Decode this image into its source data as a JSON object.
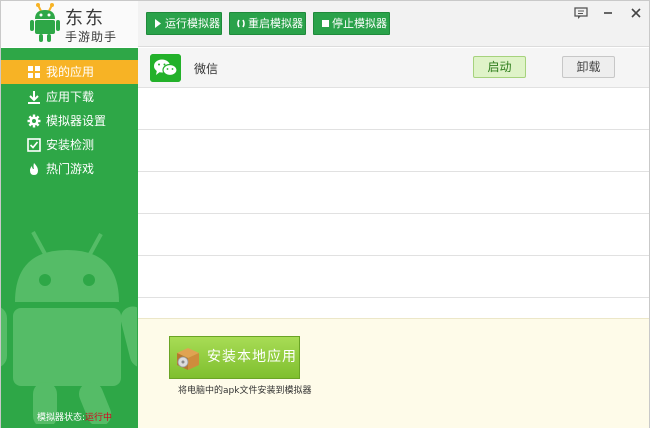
{
  "brand": {
    "name": "东东",
    "sub": "手游助手"
  },
  "toolbar": {
    "run_label": "运行模拟器",
    "restart_label": "重启模拟器",
    "stop_label": "停止模拟器"
  },
  "window_controls": [
    "message-icon",
    "minimize-icon",
    "close-icon"
  ],
  "sidebar": {
    "items": [
      {
        "label": "我的应用",
        "icon": "grid-icon",
        "active": true
      },
      {
        "label": "应用下载",
        "icon": "download-icon",
        "active": false
      },
      {
        "label": "模拟器设置",
        "icon": "gear-icon",
        "active": false
      },
      {
        "label": "安装检测",
        "icon": "checkbox-icon",
        "active": false
      },
      {
        "label": "热门游戏",
        "icon": "hot-icon",
        "active": false
      }
    ],
    "status_label": "模拟器状态:",
    "status_value": "运行中"
  },
  "apps": [
    {
      "name": "微信",
      "icon": "wechat-icon",
      "launch_label": "启动",
      "uninstall_label": "卸载"
    }
  ],
  "install": {
    "button_label": "安装本地应用",
    "hint": "将电脑中的apk文件安装到模拟器"
  },
  "colors": {
    "sidebar_green": "#2ea747",
    "active_orange": "#f7b325",
    "toolbar_green": "#2aa24a",
    "status_red": "#d6001c",
    "install_green": "#8fcd3f"
  }
}
